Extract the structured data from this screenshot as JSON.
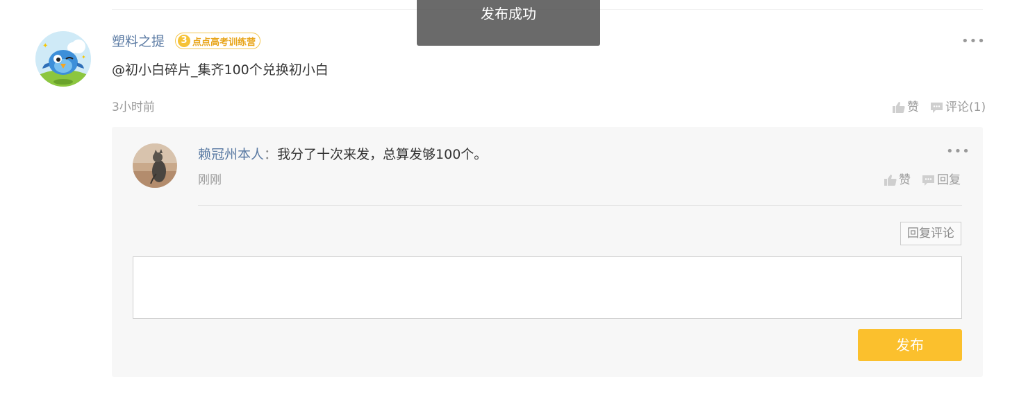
{
  "toast": {
    "message": "发布成功"
  },
  "post": {
    "author": "塑料之提",
    "badge": {
      "level": "3",
      "label": "点点高考训练营"
    },
    "content": "@初小白碎片_集齐100个兑换初小白",
    "time": "3小时前",
    "like_label": "赞",
    "comment_label": "评论(1)",
    "more_icon": "ellipsis-icon"
  },
  "reply": {
    "author": "赖冠州本人",
    "colon": "：",
    "content": "我分了十次来发，总算发够100个。",
    "time": "刚刚",
    "like_label": "赞",
    "reply_label": "回复"
  },
  "reply_box": {
    "reply_comment_button": "回复评论",
    "textarea_value": "",
    "publish_button": "发布"
  },
  "colors": {
    "accent": "#fbc02d",
    "link": "#5a7aa3",
    "badge": "#f6c236"
  }
}
